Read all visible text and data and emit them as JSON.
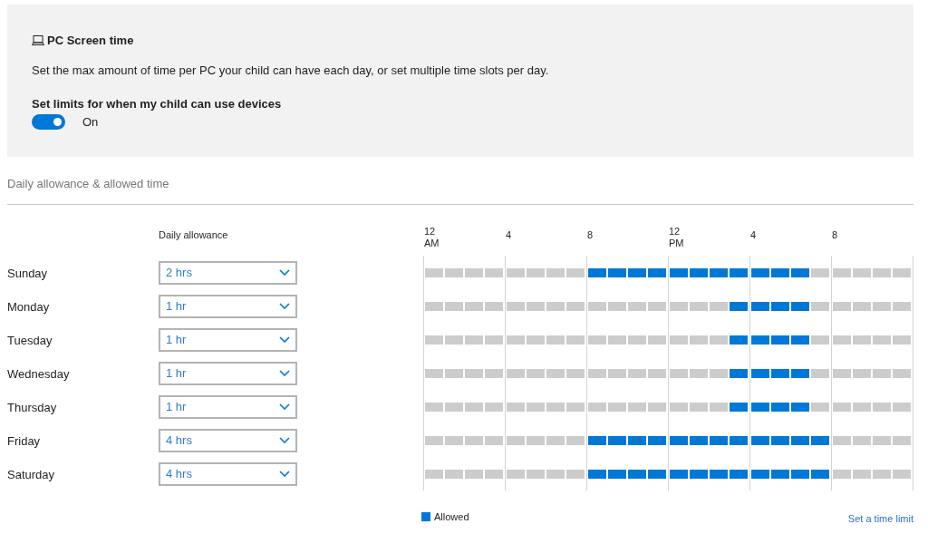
{
  "panel": {
    "title": "PC Screen time",
    "description": "Set the max amount of time per PC your child can have each day, or set multiple time slots per day.",
    "limit_label": "Set limits for when my child can use devices",
    "toggle": {
      "on": true,
      "label": "On"
    }
  },
  "section_title": "Daily allowance & allowed time",
  "allowance_header": "Daily allowance",
  "time_labels": [
    "12\nAM",
    "4",
    "8",
    "12\nPM",
    "4",
    "8"
  ],
  "days": [
    {
      "name": "Sunday",
      "allowance": "2 hrs",
      "hours": [
        false,
        false,
        false,
        false,
        false,
        false,
        false,
        false,
        true,
        true,
        true,
        true,
        true,
        true,
        true,
        true,
        true,
        true,
        true,
        false,
        false,
        false,
        false,
        false
      ]
    },
    {
      "name": "Monday",
      "allowance": "1 hr",
      "hours": [
        false,
        false,
        false,
        false,
        false,
        false,
        false,
        false,
        false,
        false,
        false,
        false,
        false,
        false,
        false,
        true,
        true,
        true,
        true,
        false,
        false,
        false,
        false,
        false
      ]
    },
    {
      "name": "Tuesday",
      "allowance": "1 hr",
      "hours": [
        false,
        false,
        false,
        false,
        false,
        false,
        false,
        false,
        false,
        false,
        false,
        false,
        false,
        false,
        false,
        true,
        true,
        true,
        true,
        false,
        false,
        false,
        false,
        false
      ]
    },
    {
      "name": "Wednesday",
      "allowance": "1 hr",
      "hours": [
        false,
        false,
        false,
        false,
        false,
        false,
        false,
        false,
        false,
        false,
        false,
        false,
        false,
        false,
        false,
        true,
        true,
        true,
        true,
        false,
        false,
        false,
        false,
        false
      ]
    },
    {
      "name": "Thursday",
      "allowance": "1 hr",
      "hours": [
        false,
        false,
        false,
        false,
        false,
        false,
        false,
        false,
        false,
        false,
        false,
        false,
        false,
        false,
        false,
        true,
        true,
        true,
        true,
        false,
        false,
        false,
        false,
        false
      ]
    },
    {
      "name": "Friday",
      "allowance": "4 hrs",
      "hours": [
        false,
        false,
        false,
        false,
        false,
        false,
        false,
        false,
        true,
        true,
        true,
        true,
        true,
        true,
        true,
        true,
        true,
        true,
        true,
        true,
        false,
        false,
        false,
        false
      ]
    },
    {
      "name": "Saturday",
      "allowance": "4 hrs",
      "hours": [
        false,
        false,
        false,
        false,
        false,
        false,
        false,
        false,
        true,
        true,
        true,
        true,
        true,
        true,
        true,
        true,
        true,
        true,
        true,
        true,
        false,
        false,
        false,
        false
      ]
    }
  ],
  "legend": {
    "label": "Allowed"
  },
  "link": "Set a time limit"
}
